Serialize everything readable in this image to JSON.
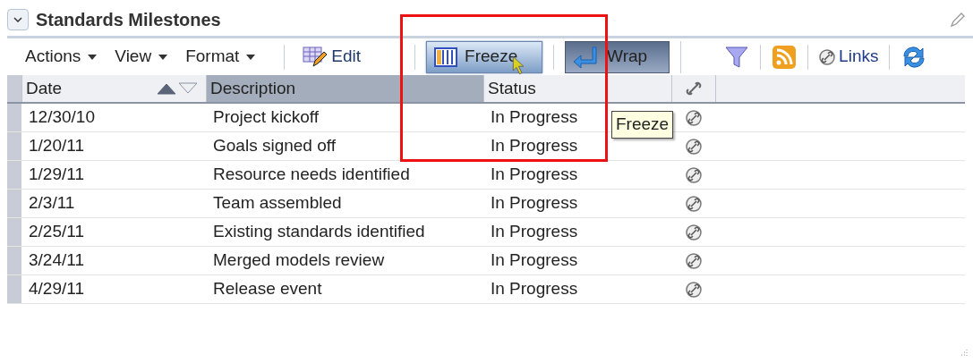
{
  "panel": {
    "title": "Standards Milestones",
    "collapsed": false
  },
  "toolbar": {
    "menus": [
      "Actions",
      "View",
      "Format"
    ],
    "edit": "Edit",
    "toggles": [
      {
        "label": "Freeze",
        "kind": "freeze",
        "pressed": false,
        "hovered": true
      },
      {
        "label": "Wrap",
        "kind": "wrap",
        "pressed": true,
        "hovered": false
      }
    ],
    "links": "Links"
  },
  "table": {
    "columns": [
      {
        "label": "Date",
        "sorted": true,
        "selected": false
      },
      {
        "label": "Description",
        "sorted": false,
        "selected": true
      },
      {
        "label": "Status",
        "sorted": false,
        "selected": false
      }
    ],
    "rows": [
      {
        "date": "12/30/10",
        "description": "Project kickoff",
        "status": "In Progress"
      },
      {
        "date": "1/20/11",
        "description": "Goals signed off",
        "status": "In Progress"
      },
      {
        "date": "1/29/11",
        "description": "Resource needs identified",
        "status": "In Progress"
      },
      {
        "date": "2/3/11",
        "description": "Team assembled",
        "status": "In Progress"
      },
      {
        "date": "2/25/11",
        "description": "Existing standards identified",
        "status": "In Progress"
      },
      {
        "date": "3/24/11",
        "description": "Merged models review",
        "status": "In Progress"
      },
      {
        "date": "4/29/11",
        "description": "Release event",
        "status": "In Progress"
      }
    ]
  },
  "tooltip": "Freeze"
}
